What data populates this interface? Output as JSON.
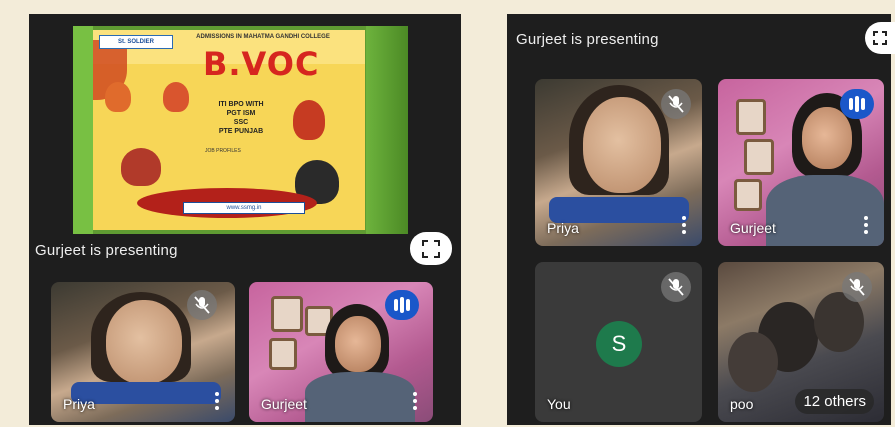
{
  "left_panel": {
    "presenting_label": "Gurjeet is presenting",
    "slide": {
      "logo_text": "St. SOLDIER",
      "header_text": "ADMISSIONS IN MAHATMA GANDHI COLLEGE",
      "headline": "B.VOC",
      "course_text": "ITI BPO WITH\nPGT ISM\nSSC\nPTE PUNJAB",
      "list_heading": "JOB PROFILES",
      "web_address": "www.ssmg.in"
    },
    "tiles": [
      {
        "name": "Priya",
        "mic": "muted"
      },
      {
        "name": "Gurjeet",
        "mic": "speaking"
      }
    ]
  },
  "right_panel": {
    "presenting_label": "Gurjeet is presenting",
    "tiles": [
      {
        "name": "Priya",
        "mic": "muted"
      },
      {
        "name": "Gurjeet",
        "mic": "speaking"
      },
      {
        "name": "You",
        "avatar_letter": "S",
        "mic": "muted"
      },
      {
        "name": "poo",
        "others_label": "12 others",
        "mic": "muted"
      }
    ]
  },
  "colors": {
    "panel_bg": "#1e1e1e",
    "speaking_accent": "#1a57c9",
    "avatar_bg": "#1e7a4c",
    "page_bg": "#f3ecd9"
  },
  "icons": [
    "mic-off-icon",
    "speaking-indicator-icon",
    "more-vert-icon",
    "fullscreen-icon"
  ]
}
